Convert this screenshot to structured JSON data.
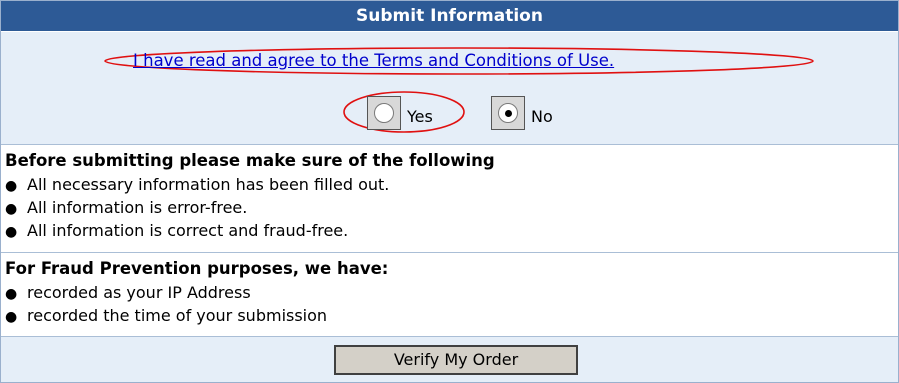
{
  "header": {
    "title": "Submit Information"
  },
  "terms": {
    "link_text": "I have read and agree to the Terms and Conditions of Use.",
    "options": [
      {
        "label": "Yes",
        "selected": false
      },
      {
        "label": "No",
        "selected": true
      }
    ]
  },
  "checklist": {
    "title": "Before submitting please make sure of the following",
    "items": [
      "All necessary information has been filled out.",
      "All information is error-free.",
      "All information is correct and fraud-free."
    ]
  },
  "fraud": {
    "title": "For Fraud Prevention purposes, we have:",
    "items": [
      "recorded as your IP Address",
      "recorded the time of your submission"
    ]
  },
  "footer": {
    "button_label": "Verify My Order"
  },
  "colors": {
    "header_bg": "#2d5a96",
    "section_bg": "#e5eef8",
    "link": "#0000cc",
    "annotation": "#e01010"
  }
}
